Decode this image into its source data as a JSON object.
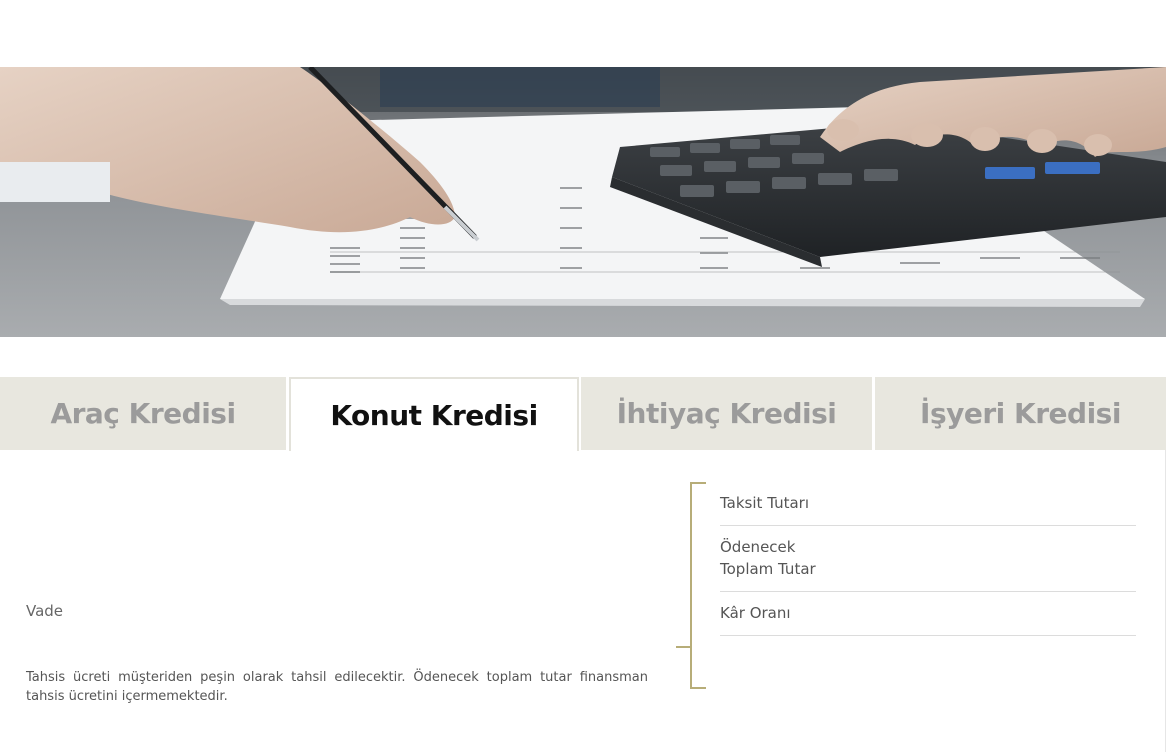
{
  "hero": {
    "icon": "calculator-paperwork-image"
  },
  "tabs": [
    {
      "label": "Araç Kredisi",
      "active": false
    },
    {
      "label": "Konut Kredisi",
      "active": true
    },
    {
      "label": "İhtiyaç Kredisi",
      "active": false
    },
    {
      "label": "İşyeri Kredisi",
      "active": false
    }
  ],
  "form": {
    "vade_label": "Vade"
  },
  "note": "Tahsis ücreti müşteriden peşin olarak tahsil edilecektir. Ödenecek toplam tutar finansman tahsis ücretini içermemektedir.",
  "results": {
    "taksit_tutari": "Taksit Tutarı",
    "odenecek_line1": "Ödenecek",
    "odenecek_line2": "Toplam Tutar",
    "kar_orani": "Kâr Oranı"
  },
  "colors": {
    "accent": "#b7ad78",
    "tab_inactive_bg": "#e8e7df",
    "tab_inactive_text": "#9b9b9b",
    "tab_active_text": "#111111"
  }
}
